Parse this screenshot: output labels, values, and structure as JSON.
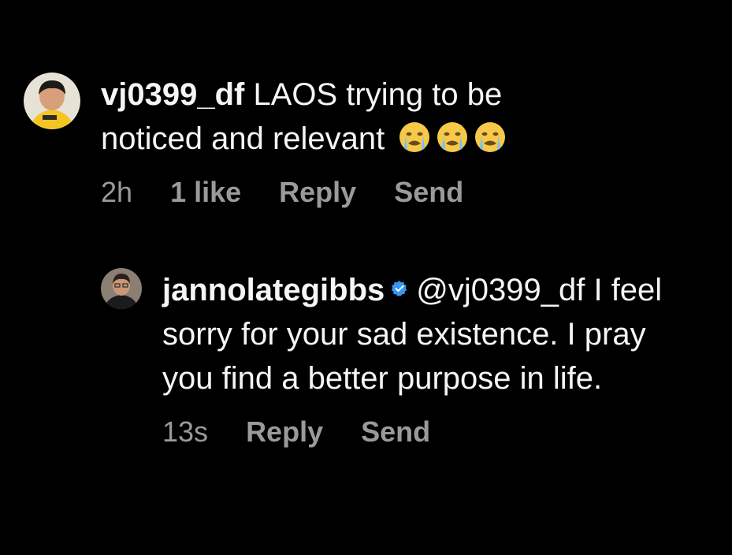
{
  "comments": [
    {
      "username": "vj0399_df",
      "text": "LAOS trying to be noticed and relevant",
      "emojis": [
        "loudly-crying-face-icon",
        "loudly-crying-face-icon",
        "loudly-crying-face-icon"
      ],
      "time": "2h",
      "likes": "1 like",
      "reply_label": "Reply",
      "send_label": "Send"
    },
    {
      "username": "jannolategibbs",
      "verified": true,
      "mention": "@vj0399_df",
      "text": "I feel sorry for your sad existence. I pray you find a better purpose in life.",
      "time": "13s",
      "reply_label": "Reply",
      "send_label": "Send"
    }
  ],
  "colors": {
    "background": "#000000",
    "text": "#f5f5f5",
    "meta": "#9a9a9a",
    "verified": "#3897f0",
    "emoji": "#f7c948"
  }
}
